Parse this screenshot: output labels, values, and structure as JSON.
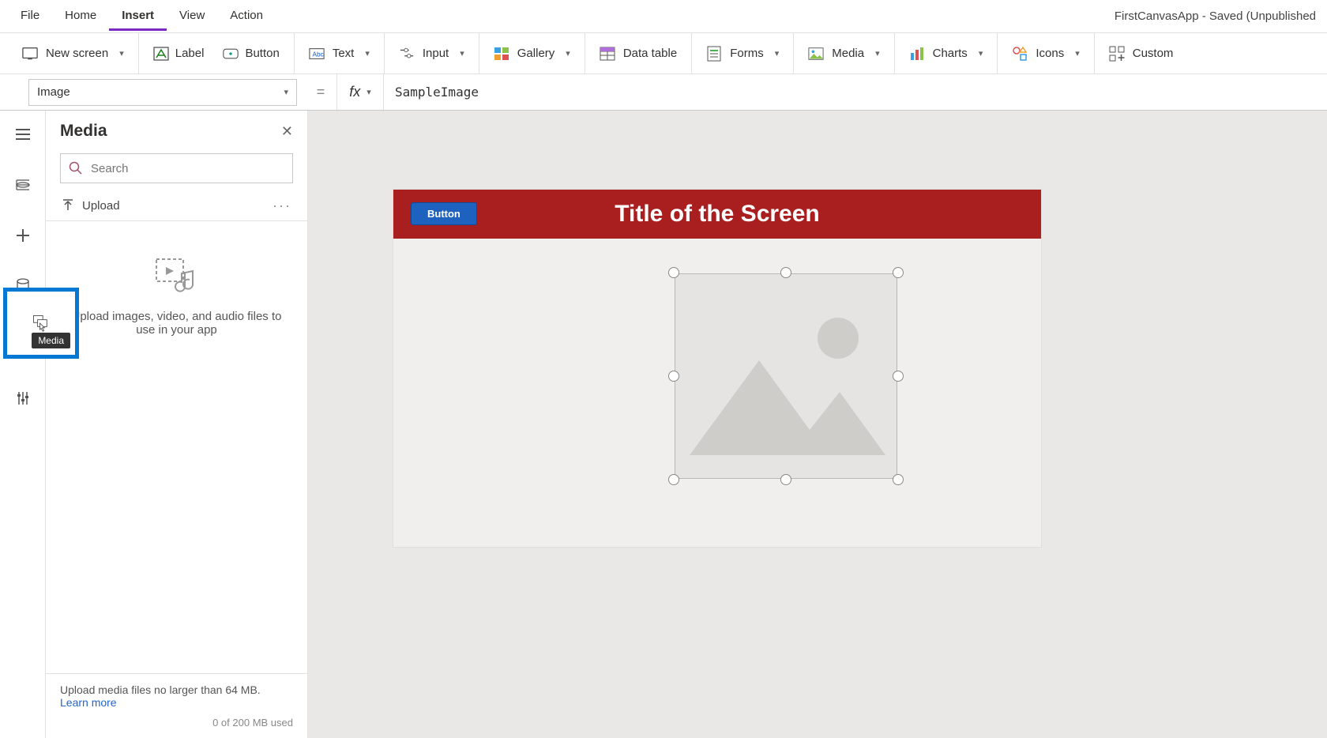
{
  "app_title": "FirstCanvasApp - Saved (Unpublished",
  "menu": {
    "file": "File",
    "home": "Home",
    "insert": "Insert",
    "view": "View",
    "action": "Action",
    "active": "Insert"
  },
  "ribbon": {
    "new_screen": "New screen",
    "label": "Label",
    "button": "Button",
    "text": "Text",
    "input": "Input",
    "gallery": "Gallery",
    "data_table": "Data table",
    "forms": "Forms",
    "media": "Media",
    "charts": "Charts",
    "icons": "Icons",
    "custom": "Custom"
  },
  "formula_bar": {
    "property": "Image",
    "value": "SampleImage"
  },
  "panel": {
    "title": "Media",
    "search_placeholder": "Search",
    "upload": "Upload",
    "empty_text": "Upload images, video, and audio files to use in your app",
    "footer_text": "Upload media files no larger than 64 MB.",
    "learn_more": "Learn more",
    "usage": "0 of 200 MB used"
  },
  "rail": {
    "tooltip": "Media"
  },
  "canvas": {
    "screen_title": "Title of the Screen",
    "button_label": "Button"
  },
  "colors": {
    "header": "#a91e1e",
    "button": "#1e62c0",
    "highlight": "#0078d4",
    "accent": "#7b2bbf"
  }
}
